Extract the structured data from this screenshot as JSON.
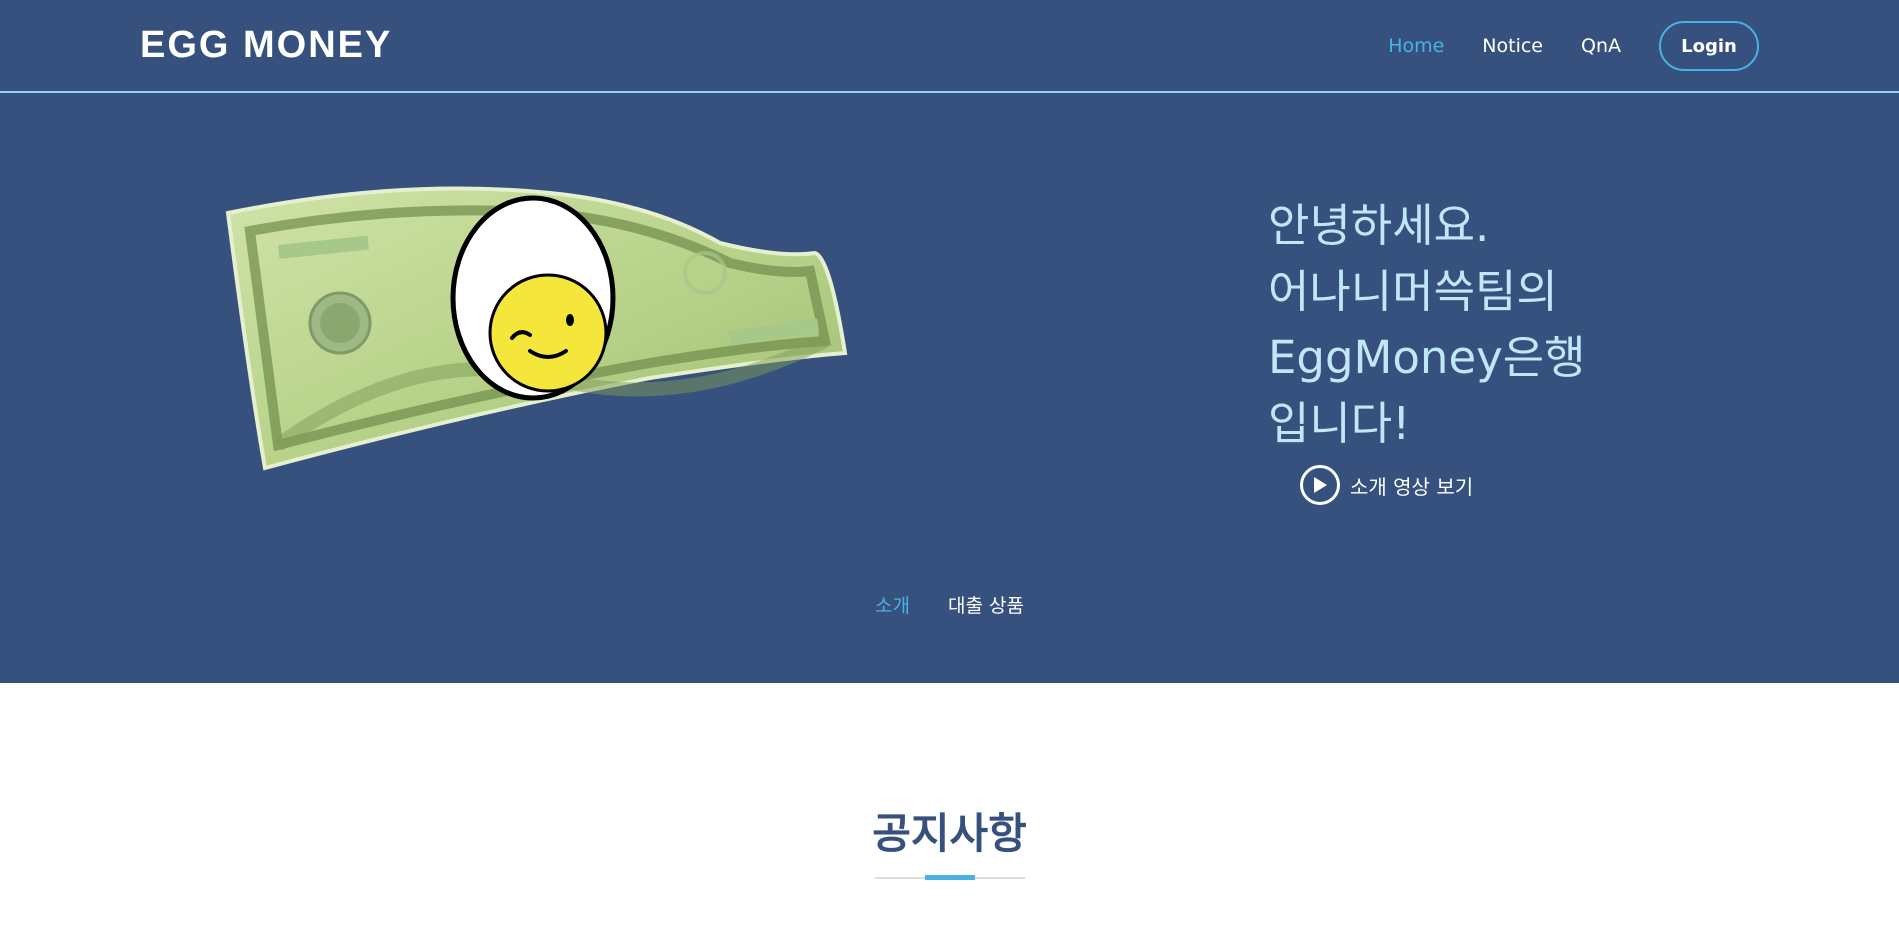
{
  "header": {
    "logo": "EGG MONEY",
    "nav": [
      {
        "label": "Home"
      },
      {
        "label": "Notice"
      },
      {
        "label": "QnA"
      }
    ],
    "login_label": "Login"
  },
  "hero": {
    "headline": "안녕하세요.\n어나니머쓱팀의\nEggMoney은행\n입니다!",
    "video_label": "소개 영상 보기",
    "tabs": [
      {
        "label": "소개"
      },
      {
        "label": "대출 상품"
      }
    ]
  },
  "notice": {
    "title": "공지사항"
  },
  "colors": {
    "header_bg": "#37517e",
    "accent": "#47b2e4",
    "hero_text": "#bfe7f8"
  }
}
